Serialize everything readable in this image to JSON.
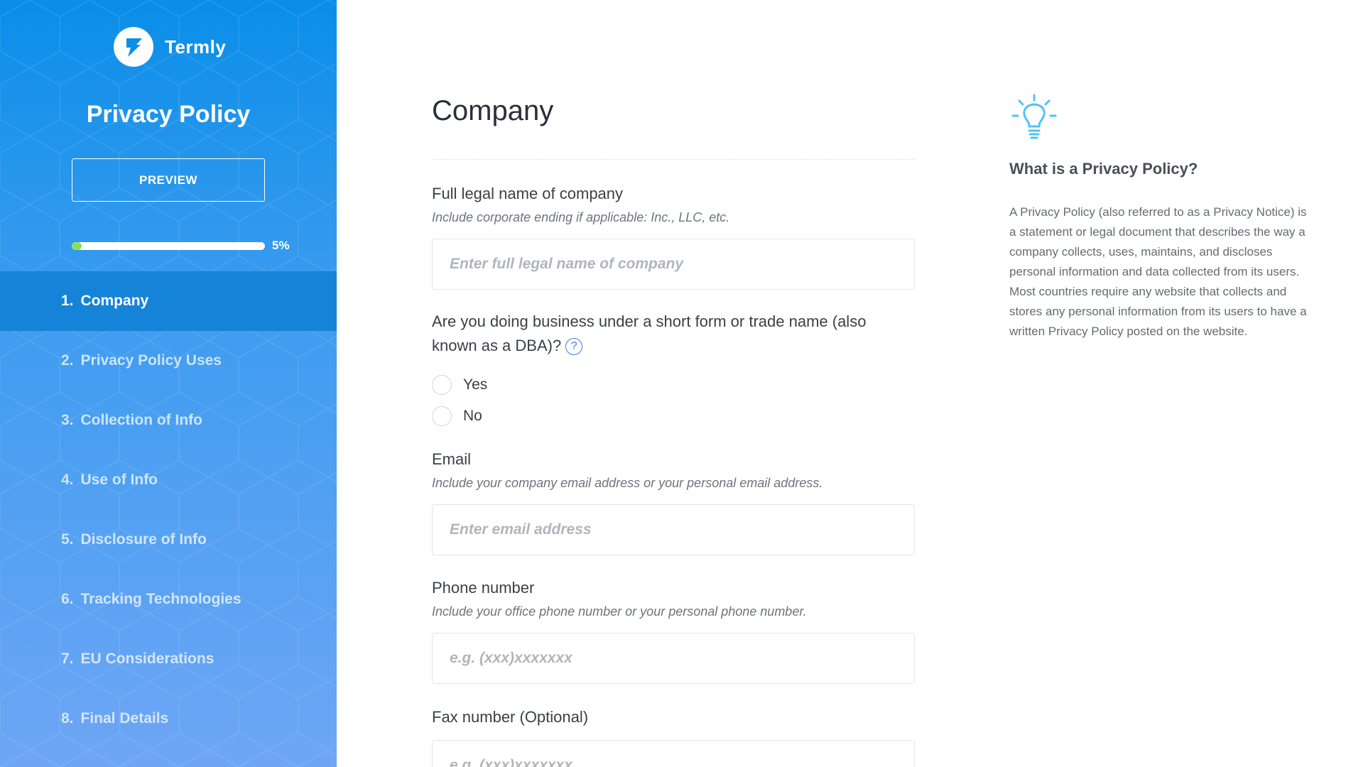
{
  "brand": {
    "name": "Termly"
  },
  "sidebar": {
    "title": "Privacy Policy",
    "preview_label": "PREVIEW",
    "progress": {
      "percent": 5,
      "label": "5%"
    },
    "steps": [
      {
        "num": "1.",
        "label": "Company"
      },
      {
        "num": "2.",
        "label": "Privacy Policy Uses"
      },
      {
        "num": "3.",
        "label": "Collection of Info"
      },
      {
        "num": "4.",
        "label": "Use of Info"
      },
      {
        "num": "5.",
        "label": "Disclosure of Info"
      },
      {
        "num": "6.",
        "label": "Tracking Technologies"
      },
      {
        "num": "7.",
        "label": "EU Considerations"
      },
      {
        "num": "8.",
        "label": "Final Details"
      }
    ],
    "active_step": 0
  },
  "main": {
    "title": "Company",
    "company_name": {
      "label": "Full legal name of company",
      "hint": "Include corporate ending if applicable: Inc., LLC, etc.",
      "placeholder": "Enter full legal name of company"
    },
    "dba": {
      "question": "Are you doing business under a short form or trade name (also known as a DBA)?",
      "help": "?",
      "options": [
        "Yes",
        "No"
      ]
    },
    "email": {
      "label": "Email",
      "hint": "Include your company email address or your personal email address.",
      "placeholder": "Enter email address"
    },
    "phone": {
      "label": "Phone number",
      "hint": "Include your office phone number or your personal phone number.",
      "placeholder": "e.g. (xxx)xxxxxxx"
    },
    "fax": {
      "label": "Fax number (Optional)",
      "placeholder": "e.g. (xxx)xxxxxxx"
    }
  },
  "tip": {
    "icon": "lightbulb-icon",
    "title": "What is a Privacy Policy?",
    "body": "A Privacy Policy (also referred to as a Privacy Notice) is a statement or legal document that describes the way a company collects, uses, maintains, and discloses personal information and data collected from its users. Most countries require any website that collects and stores any personal information from its users to have a written Privacy Policy posted on the website."
  },
  "colors": {
    "sidebar_top": "#0a8ee8",
    "sidebar_bottom": "#6ea6f5",
    "active_step": "#1583d8",
    "progress_fill": "#8be05a",
    "tip_icon": "#4fc3f7"
  }
}
